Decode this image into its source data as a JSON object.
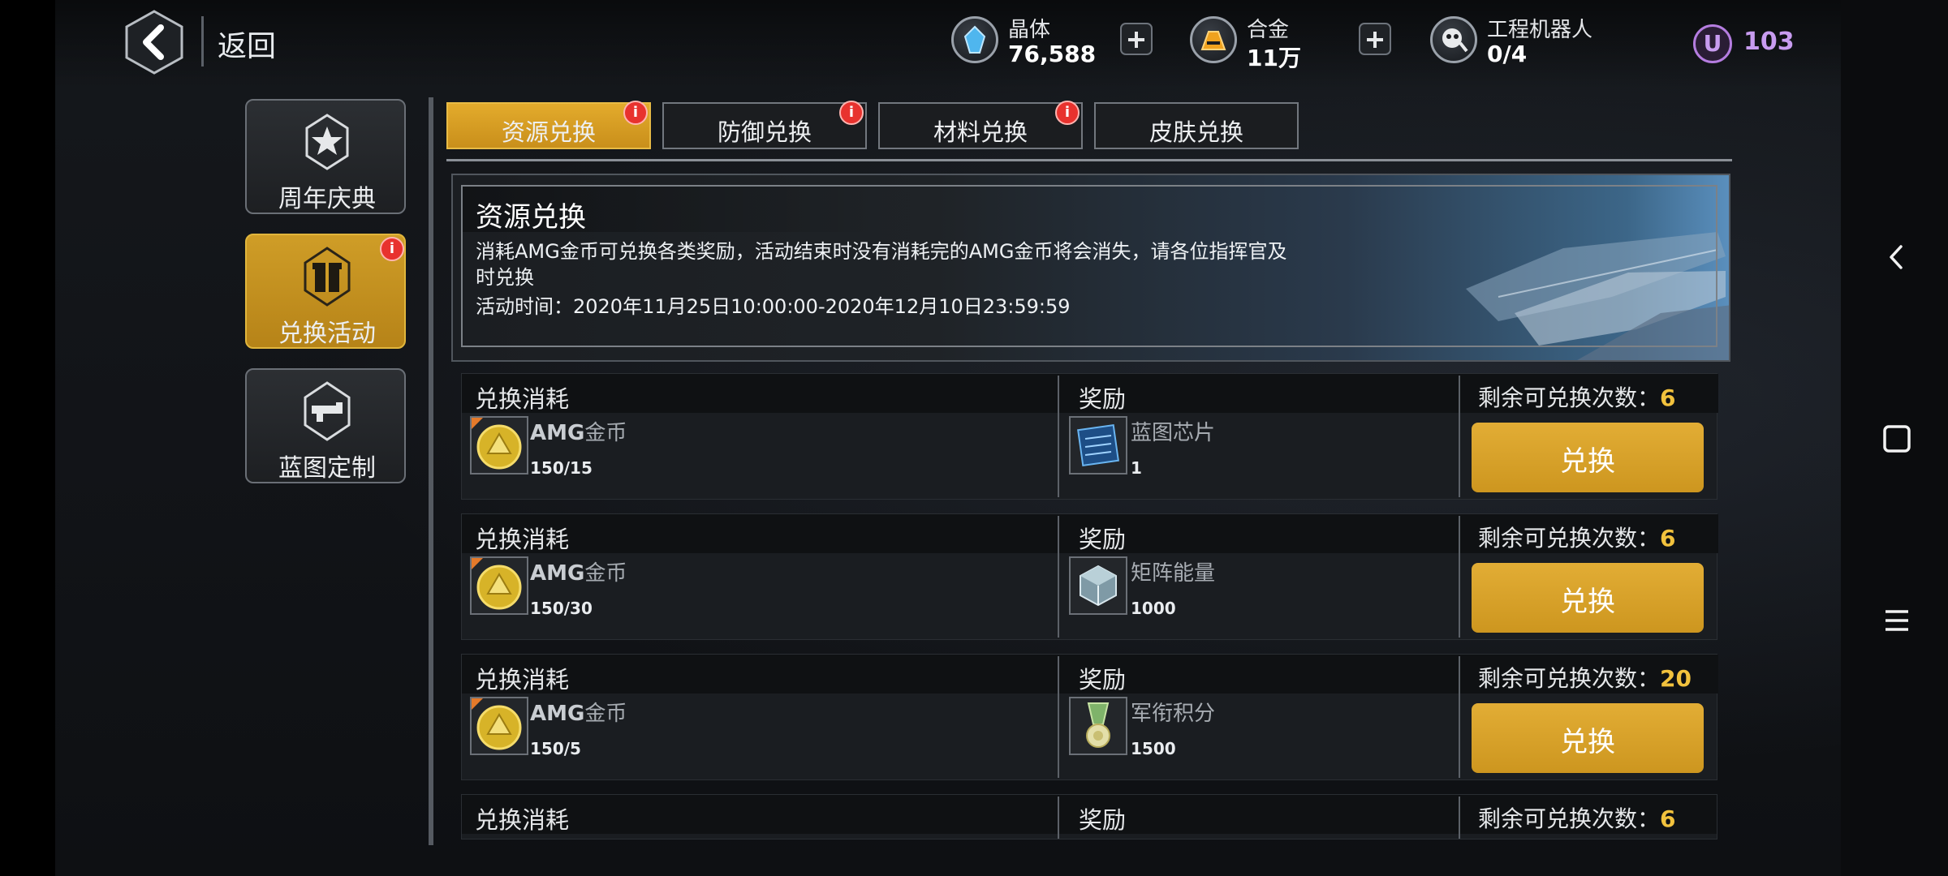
{
  "topbar": {
    "back_label": "返回",
    "resources": [
      {
        "icon": "crystal-icon",
        "name": "晶体",
        "value": "76,588"
      },
      {
        "icon": "alloy-icon",
        "name": "合金",
        "value": "11万"
      },
      {
        "icon": "robot-icon",
        "name": "工程机器人",
        "value": "0/4"
      }
    ],
    "u_currency": {
      "symbol": "U",
      "value": "103"
    },
    "cart_icon": "cart-icon"
  },
  "sidebar": {
    "items": [
      {
        "label": "周年庆典",
        "icon": "anniversary-star-icon",
        "active": false,
        "badge": false
      },
      {
        "label": "兑换活动",
        "icon": "gift-icon",
        "active": true,
        "badge": true
      },
      {
        "label": "蓝图定制",
        "icon": "blueprint-gun-icon",
        "active": false,
        "badge": false
      }
    ]
  },
  "tabs": [
    {
      "label": "资源兑换",
      "active": true,
      "badge": true
    },
    {
      "label": "防御兑换",
      "active": false,
      "badge": true
    },
    {
      "label": "材料兑换",
      "active": false,
      "badge": true
    },
    {
      "label": "皮肤兑换",
      "active": false,
      "badge": false
    }
  ],
  "badge_symbol": "i",
  "banner": {
    "title": "资源兑换",
    "description": "消耗AMG金币可兑换各类奖励，活动结束时没有消耗完的AMG金币将会消失，请各位指挥官及时兑换",
    "time_label": "活动时间：",
    "time_value": "2020年11月25日10:00:00-2020年12月10日23:59:59"
  },
  "rows": [
    {
      "cost_label": "兑换消耗",
      "reward_label": "奖励",
      "remain_label": "剩余可兑换次数：",
      "remain": "6",
      "cost": {
        "name_prefix": "AMG",
        "name": "金币",
        "qty": "150/15",
        "icon": "amg-coin-icon"
      },
      "reward": {
        "name": "蓝图芯片",
        "qty": "1",
        "icon": "blueprint-chip-icon"
      },
      "button": "兑换"
    },
    {
      "cost_label": "兑换消耗",
      "reward_label": "奖励",
      "remain_label": "剩余可兑换次数：",
      "remain": "6",
      "cost": {
        "name_prefix": "AMG",
        "name": "金币",
        "qty": "150/30",
        "icon": "amg-coin-icon"
      },
      "reward": {
        "name": "矩阵能量",
        "qty": "1000",
        "icon": "matrix-energy-icon"
      },
      "button": "兑换"
    },
    {
      "cost_label": "兑换消耗",
      "reward_label": "奖励",
      "remain_label": "剩余可兑换次数：",
      "remain": "20",
      "cost": {
        "name_prefix": "AMG",
        "name": "金币",
        "qty": "150/5",
        "icon": "amg-coin-icon"
      },
      "reward": {
        "name": "军衔积分",
        "qty": "1500",
        "icon": "rank-medal-icon"
      },
      "button": "兑换"
    },
    {
      "cost_label": "兑换消耗",
      "reward_label": "奖励",
      "remain_label": "剩余可兑换次数：",
      "remain": "6"
    }
  ],
  "colors": {
    "accent_gold": "#d9a22a",
    "badge_red": "#e8322e",
    "u_purple": "#c89cf0",
    "count_yellow": "#f2c23d"
  }
}
